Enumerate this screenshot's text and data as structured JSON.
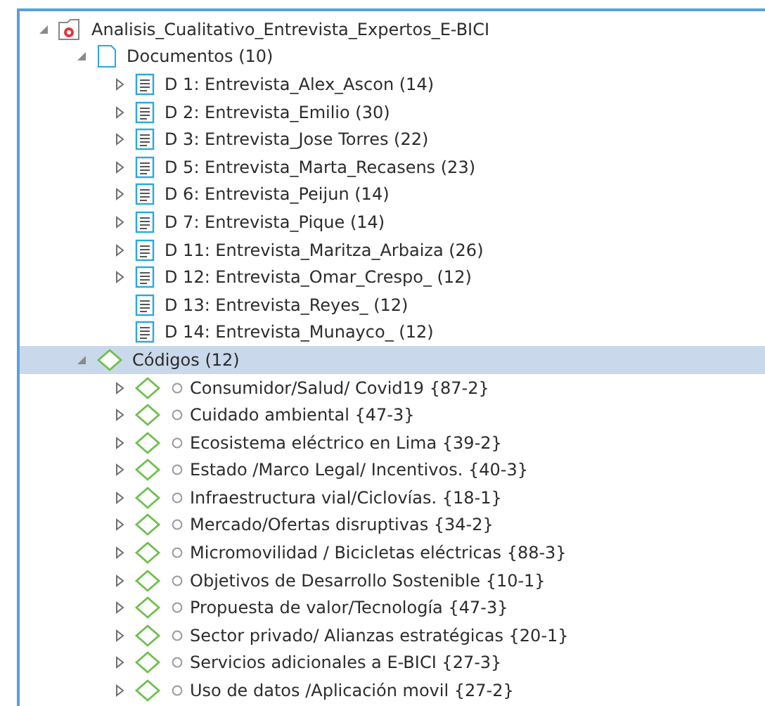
{
  "tree": [
    {
      "kind": "project",
      "label": "Analisis_Cualitativo_Entrevista_Expertos_E-BICI",
      "expanded": true,
      "selected": false,
      "children": [
        {
          "kind": "folder",
          "label": "Documentos (10)",
          "expanded": true,
          "selected": false,
          "children": [
            {
              "kind": "document",
              "label": "D 1: Entrevista_Alex_Ascon (14)",
              "expandable": true,
              "selected": false
            },
            {
              "kind": "document",
              "label": "D 2: Entrevista_Emilio (30)",
              "expandable": true,
              "selected": false
            },
            {
              "kind": "document",
              "label": "D 3: Entrevista_Jose Torres (22)",
              "expandable": true,
              "selected": false
            },
            {
              "kind": "document",
              "label": "D 5: Entrevista_Marta_Recasens (23)",
              "expandable": true,
              "selected": false
            },
            {
              "kind": "document",
              "label": "D 6: Entrevista_Peijun (14)",
              "expandable": true,
              "selected": false
            },
            {
              "kind": "document",
              "label": "D 7: Entrevista_Pique (14)",
              "expandable": true,
              "selected": false
            },
            {
              "kind": "document",
              "label": "D 11: Entrevista_Maritza_Arbaiza (26)",
              "expandable": true,
              "selected": false
            },
            {
              "kind": "document",
              "label": "D 12: Entrevista_Omar_Crespo_ (12)",
              "expandable": true,
              "selected": false
            },
            {
              "kind": "document",
              "label": "D 13: Entrevista_Reyes_ (12)",
              "expandable": false,
              "selected": false
            },
            {
              "kind": "document",
              "label": "D 14: Entrevista_Munayco_ (12)",
              "expandable": false,
              "selected": false
            }
          ]
        },
        {
          "kind": "codes",
          "label": "Códigos (12)",
          "expanded": true,
          "selected": true,
          "children": [
            {
              "kind": "code",
              "label": "Consumidor/Salud/ Covid19 {87-2}",
              "expandable": true,
              "selected": false
            },
            {
              "kind": "code",
              "label": "Cuidado ambiental {47-3}",
              "expandable": true,
              "selected": false
            },
            {
              "kind": "code",
              "label": "Ecosistema eléctrico en Lima {39-2}",
              "expandable": true,
              "selected": false
            },
            {
              "kind": "code",
              "label": "Estado /Marco Legal/ Incentivos. {40-3}",
              "expandable": true,
              "selected": false
            },
            {
              "kind": "code",
              "label": "Infraestructura vial/Ciclovías. {18-1}",
              "expandable": true,
              "selected": false
            },
            {
              "kind": "code",
              "label": "Mercado/Ofertas disruptivas {34-2}",
              "expandable": true,
              "selected": false
            },
            {
              "kind": "code",
              "label": "Micromovilidad / Bicicletas eléctricas {88-3}",
              "expandable": true,
              "selected": false
            },
            {
              "kind": "code",
              "label": "Objetivos de Desarrollo Sostenible {10-1}",
              "expandable": true,
              "selected": false
            },
            {
              "kind": "code",
              "label": "Propuesta de valor/Tecnología {47-3}",
              "expandable": true,
              "selected": false
            },
            {
              "kind": "code",
              "label": "Sector privado/ Alianzas estratégicas {20-1}",
              "expandable": true,
              "selected": false
            },
            {
              "kind": "code",
              "label": "Servicios adicionales a E-BICI {27-3}",
              "expandable": true,
              "selected": false
            },
            {
              "kind": "code",
              "label": "Uso de datos /Aplicación movil {27-2}",
              "expandable": true,
              "selected": false
            }
          ]
        }
      ]
    }
  ]
}
